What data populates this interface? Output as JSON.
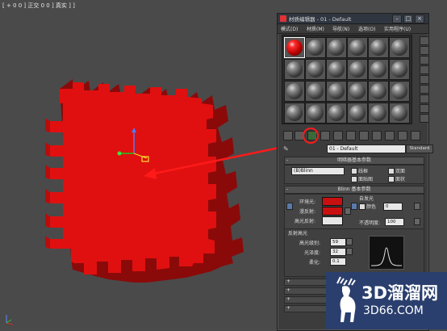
{
  "viewport": {
    "label": "[ + 0 0 ] 正交 0 0 ] 真实 ] ]",
    "object_color": "#e01010"
  },
  "material_editor": {
    "title": "材质编辑器 - 01 - Default",
    "window_buttons": [
      "–",
      "□",
      "×"
    ],
    "menu": [
      "模式(D)",
      "材质(M)",
      "导航(N)",
      "选项(O)",
      "实用程序(U)"
    ],
    "material_name": "01 - Default",
    "type_button": "Standard",
    "shader_rollout": {
      "header": "明暗器基本参数",
      "shader": "(B)Blinn",
      "options": [
        "线框",
        "双面",
        "面贴图",
        "面状"
      ]
    },
    "blinn_rollout": {
      "header": "Blinn 基本参数",
      "self_illum_label": "自发光",
      "color_label": "颜色",
      "color_value": "0",
      "ambient_label": "环境光:",
      "diffuse_label": "漫反射:",
      "specular_label": "高光反射:",
      "opacity_label": "不透明度:",
      "opacity_value": "100",
      "ambient_color": "#c81010",
      "diffuse_color": "#c81010",
      "specular_color": "#e6e6e6"
    },
    "specular_highlights": {
      "header": "反射高光",
      "level_label": "高光级别:",
      "level_value": "59",
      "gloss_label": "光泽度:",
      "gloss_value": "32",
      "soften_label": "柔化:",
      "soften_value": "0.1"
    }
  },
  "watermark": {
    "brand": "3D溜溜网",
    "url": "3D66.COM"
  }
}
